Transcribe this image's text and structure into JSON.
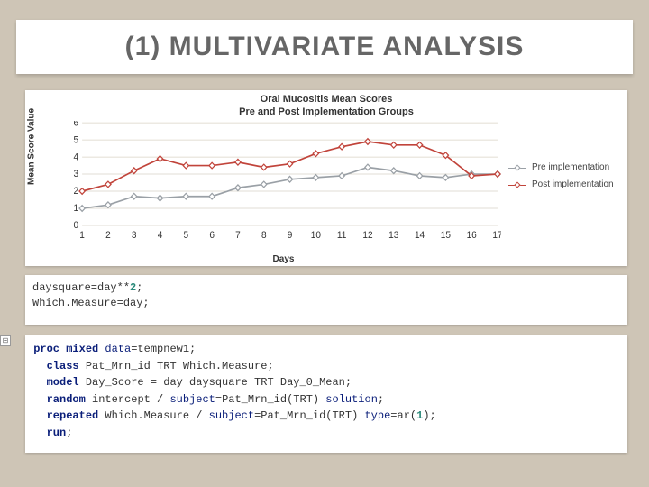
{
  "title": "(1) MULTIVARIATE ANALYSIS",
  "chart_data": {
    "type": "line",
    "title_line1": "Oral Mucositis Mean Scores",
    "title_line2": "Pre and Post Implementation Groups",
    "xlabel": "Days",
    "ylabel": "Mean Score Value",
    "x": [
      1,
      2,
      3,
      4,
      5,
      6,
      7,
      8,
      9,
      10,
      11,
      12,
      13,
      14,
      15,
      16,
      17
    ],
    "ylim": [
      0,
      6
    ],
    "yticks": [
      0,
      1,
      2,
      3,
      4,
      5,
      6
    ],
    "series": [
      {
        "name": "Pre implementation",
        "color": "#9aa0a6",
        "values": [
          1.0,
          1.2,
          1.7,
          1.6,
          1.7,
          1.7,
          2.2,
          2.4,
          2.7,
          2.8,
          2.9,
          3.4,
          3.2,
          2.9,
          2.8,
          3.0,
          3.0
        ]
      },
      {
        "name": "Post implementation",
        "color": "#c1443b",
        "values": [
          2.0,
          2.4,
          3.2,
          3.9,
          3.5,
          3.5,
          3.7,
          3.4,
          3.6,
          4.2,
          4.6,
          4.9,
          4.7,
          4.7,
          4.1,
          2.9,
          3.0
        ]
      }
    ]
  },
  "code1": {
    "line1_a": "daysquare=day**",
    "line1_b": "2",
    "line1_c": ";",
    "line2": "Which.Measure=day;"
  },
  "code2": {
    "l1": [
      "proc mixed ",
      "data",
      "=tempnew1;"
    ],
    "l2": [
      "class",
      " Pat_Mrn_id TRT Which.Measure;"
    ],
    "l3": [
      "model",
      " Day_Score = day daysquare TRT Day_0_Mean;"
    ],
    "l4": [
      "random",
      " intercept / ",
      "subject",
      "=Pat_Mrn_id(TRT) ",
      "solution",
      ";"
    ],
    "l5": [
      "repeated",
      " Which.Measure / ",
      "subject",
      "=Pat_Mrn_id(TRT) ",
      "type",
      "=ar(",
      "1",
      ");"
    ],
    "l6": [
      "run",
      ";"
    ]
  },
  "toggle": "⊟"
}
